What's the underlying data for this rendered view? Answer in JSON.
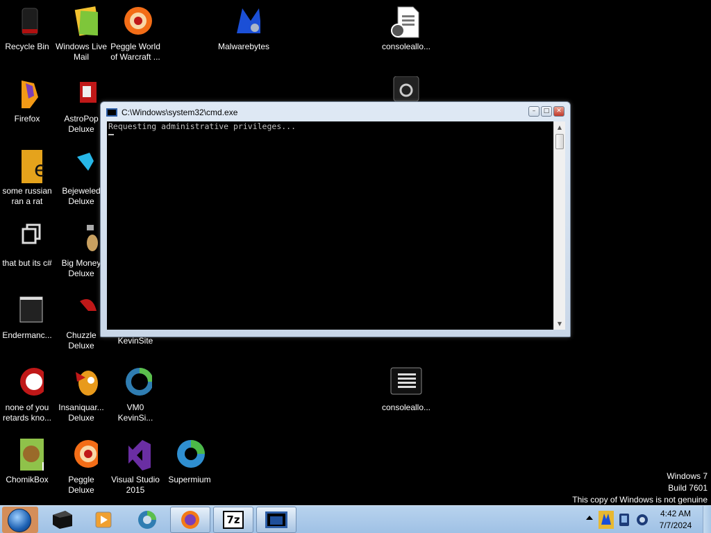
{
  "desktop": {
    "icons": [
      {
        "label": "Recycle Bin",
        "icon": "recycle-bin-icon"
      },
      {
        "label": "Windows Live Mail",
        "icon": "windows-live-mail-icon"
      },
      {
        "label": "Peggle World of Warcraft ...",
        "icon": "peggle-icon"
      },
      {
        "label": "Malwarebytes",
        "icon": "malwarebytes-icon"
      },
      {
        "label": "consoleallo...",
        "icon": "document-icon"
      },
      {
        "label": "Firefox",
        "icon": "firefox-icon"
      },
      {
        "label": "AstroPop Deluxe",
        "icon": "astropop-icon"
      },
      {
        "label": "some russian ran a rat",
        "icon": "app-icon"
      },
      {
        "label": "Bejeweled Deluxe",
        "icon": "bejeweled-icon"
      },
      {
        "label": "that but its c#",
        "icon": "shortcut-icon"
      },
      {
        "label": "Big Money Deluxe",
        "icon": "big-money-icon"
      },
      {
        "label": "Endermanc...",
        "icon": "window-icon"
      },
      {
        "label": "Chuzzle Deluxe",
        "icon": "chuzzle-icon"
      },
      {
        "label": "KevinSite",
        "icon": "website-icon"
      },
      {
        "label": "none of you retards kno...",
        "icon": "app-icon"
      },
      {
        "label": "Insaniquar... Deluxe",
        "icon": "insaniquarium-icon"
      },
      {
        "label": "VM0 KevinSi...",
        "icon": "vm-icon"
      },
      {
        "label": "consoleallo...",
        "icon": "console-icon"
      },
      {
        "label": "ChomikBox",
        "icon": "chomikbox-icon"
      },
      {
        "label": "Peggle Deluxe",
        "icon": "peggle-icon"
      },
      {
        "label": "Visual Studio 2015",
        "icon": "visual-studio-icon"
      },
      {
        "label": "Supermium",
        "icon": "supermium-icon"
      },
      {
        "label": "",
        "icon": "settings-icon"
      }
    ]
  },
  "console_window": {
    "title": "C:\\Windows\\system32\\cmd.exe",
    "output_line": "Requesting administrative privileges...",
    "minimize_glyph": "–",
    "maximize_glyph": "□",
    "close_glyph": "✕"
  },
  "watermark": {
    "line1": "Windows 7",
    "line2": "Build 7601",
    "line3": "This copy of Windows is not genuine"
  },
  "taskbar": {
    "pinned": [
      "media-center-icon",
      "media-player-icon",
      "browser-icon",
      "firefox-icon",
      "7zip-icon",
      "cmd-icon"
    ],
    "seven_zip_label": "7z",
    "time": "4:42 AM",
    "date": "7/7/2024"
  },
  "colors": {
    "desktop_bg": "#000000",
    "taskbar": "#a9c9ea",
    "console_text": "#c0c0c0"
  }
}
